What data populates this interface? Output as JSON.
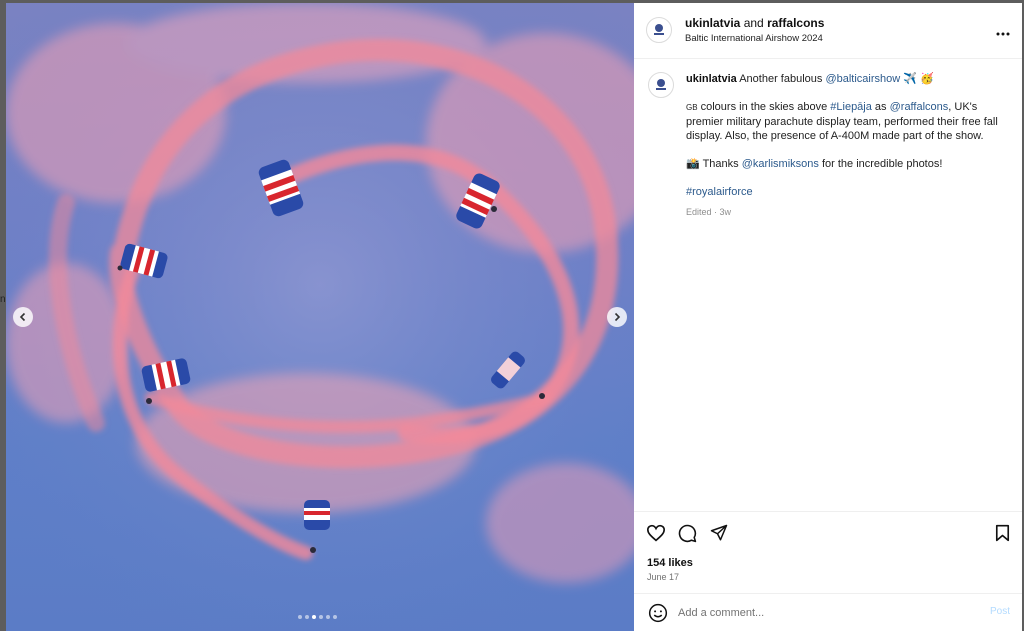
{
  "post": {
    "author": "ukinlatvia",
    "joiner": "and",
    "coauthor": "raffalcons",
    "location": "Baltic International Airshow 2024"
  },
  "caption": {
    "author": "ukinlatvia",
    "line1_text": "Another fabulous",
    "line1_mention": "@balticairshow",
    "line1_emojis": "✈️ 🥳",
    "flag_label": "GB",
    "line2_text": "colours in the skies above",
    "hashtag_place": "#Liepāja",
    "line2_as": "as",
    "mention_falcons": "@raffalcons",
    "line2_rest": ", UK's premier military parachute display team, performed their free fall display. Also, the presence of A-400M made part of the show.",
    "camera_emoji": "📸",
    "thanks_text": "Thanks",
    "mention_photographer": "@karlismiksons",
    "thanks_rest": "for the incredible photos!",
    "hashtag": "#royalairforce",
    "edited": "Edited · 3w"
  },
  "stats": {
    "likes": "154 likes",
    "date": "June 17"
  },
  "comment": {
    "placeholder": "Add a comment...",
    "post_label": "Post"
  },
  "edge_fragment": "n",
  "carousel": {
    "count": 6,
    "active_index": 2
  },
  "colors": {
    "link": "#2c5a8c",
    "smoke": "#f08a9a",
    "sky": "#6f7fc6",
    "post_disabled": "#b3dbff"
  }
}
